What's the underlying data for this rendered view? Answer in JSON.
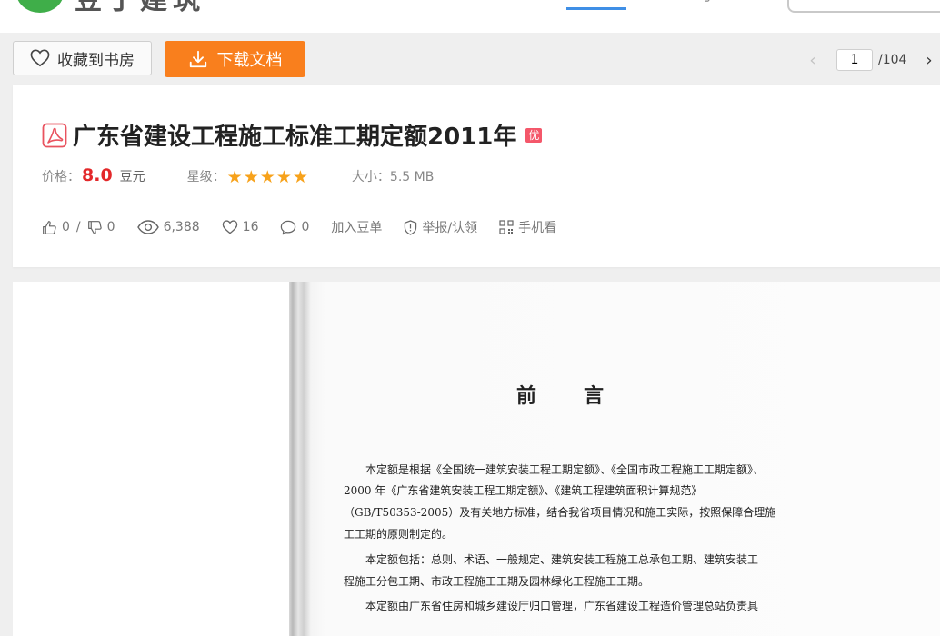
{
  "header": {
    "logo_text": "豆丁建筑"
  },
  "toolbar": {
    "favorite_label": "收藏到书房",
    "download_label": "下载文档",
    "current_page": "1",
    "total_pages": "/104"
  },
  "document": {
    "title": "广东省建设工程施工标准工期定额2011年",
    "badge": "优",
    "price_label": "价格：",
    "price_value": "8.0",
    "price_unit": "豆元",
    "rating_label": "星级：",
    "rating_value": 5,
    "rating_max": 5,
    "size_label": "大小：",
    "size_value": "5.5 MB"
  },
  "actions": {
    "likes": "0",
    "slash": "/",
    "dislikes": "0",
    "views": "6,388",
    "favorites": "16",
    "comments": "0",
    "add_bean": "加入豆单",
    "report": "举报/认领",
    "mobile": "手机看"
  },
  "preview": {
    "heading": "前言",
    "lines": [
      "本定额是根据《全国统一建筑安装工程工期定额》、《全国市政工程施工工期定额》、",
      "2000 年《广东省建筑安装工程工期定额》、《建筑工程建筑面积计算规范》",
      "（GB/T50353-2005）及有关地方标准，结合我省项目情况和施工实际，按照保障合理施",
      "工工期的原则制定的。",
      "本定额包括：总则、术语、一般规定、建筑安装工程施工总承包工期、建筑安装工",
      "程施工分包工期、市政工程施工工期及园林绿化工程施工工期。",
      "本定额由广东省住房和城乡建设厅归口管理，广东省建设工程造价管理总站负责具"
    ]
  },
  "colors": {
    "accent_orange": "#f97f1d",
    "price_red": "#e3282a",
    "star_gold": "#f7a21b",
    "nav_blue": "#3f8fe6",
    "logo_green": "#3fae49"
  }
}
